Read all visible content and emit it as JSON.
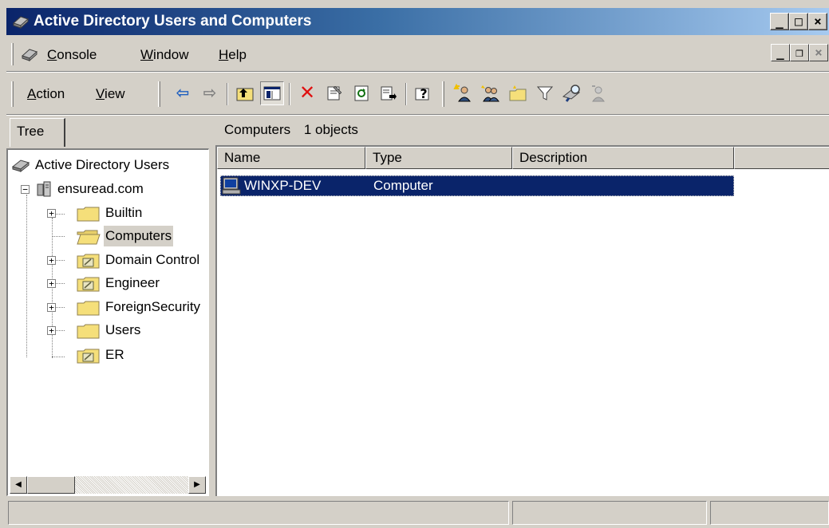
{
  "window": {
    "title": "Active Directory Users and Computers",
    "caption_buttons": {
      "minimize": "_",
      "maximize": "□",
      "close": "×"
    }
  },
  "menubar": {
    "items": [
      {
        "label": "Console",
        "accel": "C"
      },
      {
        "label": "Window",
        "accel": "W"
      },
      {
        "label": "Help",
        "accel": "H"
      }
    ],
    "mdi_buttons": {
      "minimize": "_",
      "restore": "❐",
      "close": "×"
    }
  },
  "toolbar": {
    "menus": [
      {
        "label": "Action",
        "accel": "A"
      },
      {
        "label": "View",
        "accel": "V"
      }
    ],
    "buttons": [
      {
        "name": "back-icon",
        "glyph": "⇦",
        "color": "#1f5fbf"
      },
      {
        "name": "forward-icon",
        "glyph": "⇨",
        "color": "#808080"
      },
      {
        "name": "up-folder-icon",
        "glyph": "⮤",
        "color": "#806000"
      },
      {
        "name": "show-hide-tree-icon",
        "glyph": "▥",
        "color": "#0a246a"
      },
      {
        "name": "delete-icon",
        "glyph": "✕",
        "color": "#e01010"
      },
      {
        "name": "properties-icon",
        "glyph": "🗒",
        "color": "#404040"
      },
      {
        "name": "refresh-icon",
        "glyph": "⟳",
        "color": "#107010"
      },
      {
        "name": "export-list-icon",
        "glyph": "⎙",
        "color": "#404040"
      },
      {
        "name": "help-icon",
        "glyph": "?",
        "color": "#0a246a"
      },
      {
        "name": "new-user-icon",
        "glyph": "👤",
        "color": "#806000"
      },
      {
        "name": "new-group-icon",
        "glyph": "👥",
        "color": "#806000"
      },
      {
        "name": "new-ou-icon",
        "glyph": "📁",
        "color": "#806000"
      },
      {
        "name": "filter-icon",
        "glyph": "▽",
        "color": "#404040"
      },
      {
        "name": "find-icon",
        "glyph": "🔍",
        "color": "#404040"
      },
      {
        "name": "add-to-group-icon",
        "glyph": "👥",
        "color": "#a0a0a0"
      }
    ]
  },
  "tree": {
    "tab_label": "Tree",
    "items": [
      {
        "label": "Active Directory Users",
        "icon": "snapin-icon"
      },
      {
        "label": "ensuread.com",
        "icon": "domain-icon"
      },
      {
        "label": "Builtin",
        "icon": "folder-icon"
      },
      {
        "label": "Computers",
        "icon": "open-folder-icon"
      },
      {
        "label": "Domain Control",
        "icon": "ou-icon"
      },
      {
        "label": "Engineer",
        "icon": "ou-icon"
      },
      {
        "label": "ForeignSecurity",
        "icon": "folder-icon"
      },
      {
        "label": "Users",
        "icon": "folder-icon"
      },
      {
        "label": "ER",
        "icon": "ou-icon"
      }
    ]
  },
  "content": {
    "container_name": "Computers",
    "object_count": "1 objects",
    "columns": [
      "Name",
      "Type",
      "Description"
    ],
    "rows": [
      {
        "name": "WINXP-DEV",
        "type": "Computer",
        "description": ""
      }
    ]
  },
  "colors": {
    "title_start": "#0a246a",
    "title_end": "#a6caf0",
    "selection": "#0a246a",
    "face": "#d4d0c8",
    "folder": "#f5df7a"
  }
}
